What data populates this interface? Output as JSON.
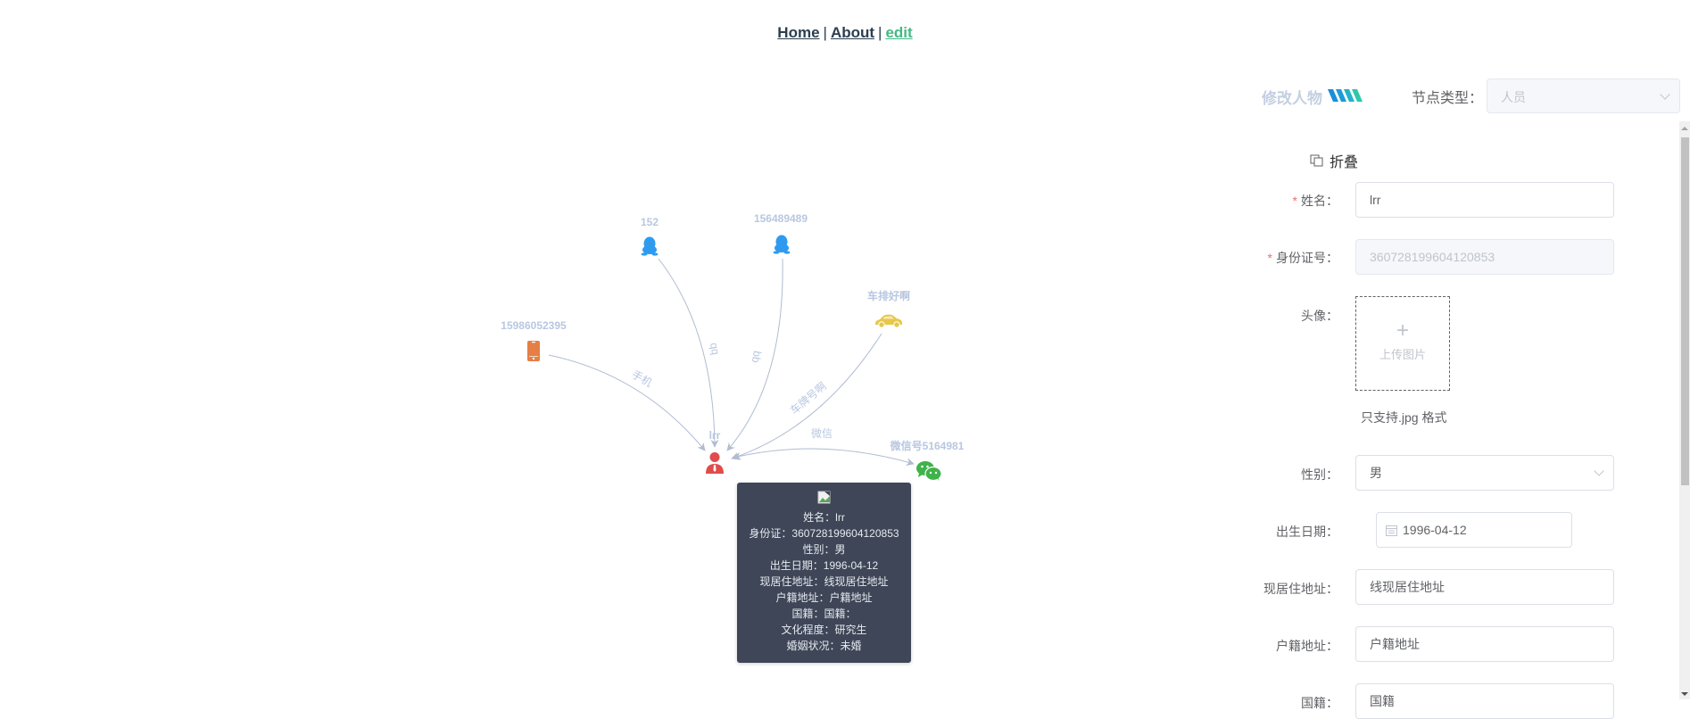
{
  "nav": {
    "home": "Home",
    "about": "About",
    "edit": "edit",
    "separator": "|"
  },
  "graph": {
    "center": {
      "label": "lrr",
      "icon": "person-icon",
      "color": "#e04c4c"
    },
    "nodes": [
      {
        "id": "phone",
        "label": "15986052395",
        "icon": "phone-icon",
        "color": "#e57f45",
        "edge_label": "手机"
      },
      {
        "id": "qq1",
        "label": "152",
        "icon": "qq-penguin-icon",
        "color": "#2e9bf0",
        "edge_label": "qq"
      },
      {
        "id": "qq2",
        "label": "156489489",
        "icon": "qq-penguin-icon",
        "color": "#2e9bf0",
        "edge_label": "qq"
      },
      {
        "id": "car",
        "label": "车排好啊",
        "icon": "car-icon",
        "color": "#e6c84a",
        "edge_label": "车牌号啊"
      },
      {
        "id": "wechat",
        "label": "微信号5164981",
        "icon": "wechat-icon",
        "color": "#3fb34a",
        "edge_label": "微信"
      }
    ],
    "edge_color": "#b0bcd0",
    "label_color": "#b8c7e0"
  },
  "tooltip": {
    "image_alt": "broken-image",
    "lines": [
      "姓名：lrr",
      "身份证：360728199604120853",
      "性别：男",
      "出生日期：1996-04-12",
      "现居住地址：线现居住地址",
      "户籍地址：户籍地址",
      "国籍：国籍：",
      "文化程度：研究生",
      "婚姻状况：未婚"
    ]
  },
  "panel": {
    "title": "修改人物",
    "node_type_label": "节点类型：",
    "node_type_value": "人员",
    "fold_label": "折叠",
    "fields": {
      "name": {
        "label": "姓名：",
        "required": true,
        "value": "lrr"
      },
      "id_number": {
        "label": "身份证号：",
        "required": true,
        "value": "360728199604120853",
        "disabled": true
      },
      "avatar": {
        "label": "头像：",
        "upload_text": "上传图片",
        "hint": "只支持.jpg 格式"
      },
      "gender": {
        "label": "性别：",
        "value": "男"
      },
      "birth_date": {
        "label": "出生日期：",
        "value": "1996-04-12"
      },
      "current_address": {
        "label": "现居住地址：",
        "value": "线现居住地址"
      },
      "household_address": {
        "label": "户籍地址：",
        "value": "户籍地址"
      },
      "nationality": {
        "label": "国籍：",
        "value": "国籍"
      }
    }
  }
}
